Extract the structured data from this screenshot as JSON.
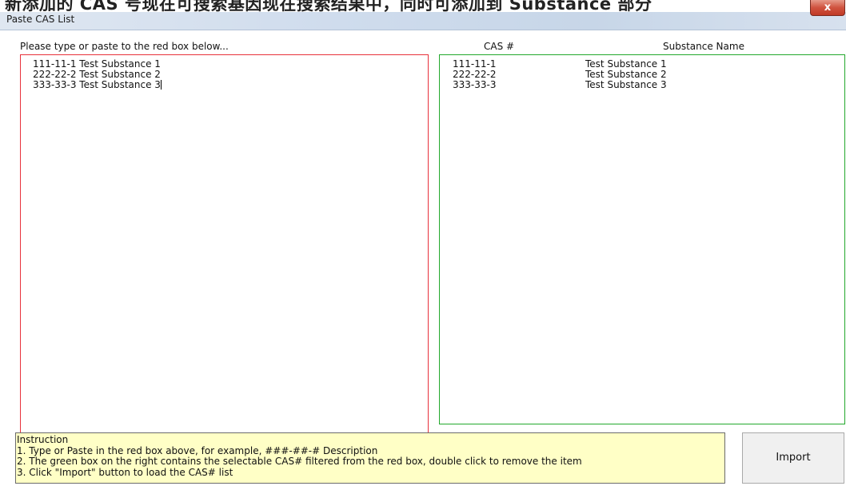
{
  "banner": {
    "text": "新添加的 CAS 号现在可搜索基因现在搜索结果中，同时可添加到 Substance 部分"
  },
  "window": {
    "title": "Paste CAS List",
    "close_label": "x"
  },
  "left_panel": {
    "label": "Please type or paste to the red box below...",
    "lines": [
      "111-11-1 Test Substance 1",
      "222-22-2 Test Substance 2",
      "333-33-3 Test Substance 3"
    ]
  },
  "right_panel": {
    "col_cas": "CAS #",
    "col_name": "Substance Name",
    "rows": [
      {
        "cas": "111-11-1",
        "name": "Test Substance 1"
      },
      {
        "cas": "222-22-2",
        "name": "Test Substance 2"
      },
      {
        "cas": "333-33-3",
        "name": "Test Substance 3"
      }
    ]
  },
  "instruction": {
    "title": "Instruction",
    "lines": [
      "1. Type or Paste in the red box above, for example, ###-##-# Description",
      "2. The green box on the right contains the selectable CAS# filtered from the red box, double click to remove the item",
      "3. Click \"Import\" button to load the CAS# list"
    ]
  },
  "import_button": {
    "label": "Import"
  },
  "colors": {
    "red_box": "#e8313b",
    "green_box": "#22a82c",
    "instruction_bg": "#ffffc6"
  }
}
